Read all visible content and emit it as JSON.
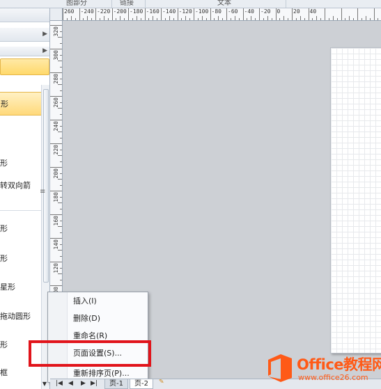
{
  "ribbon": {
    "groups": [
      "图部分",
      "链接",
      "文本"
    ]
  },
  "shapes_pane": {
    "items": [
      {
        "label": "形",
        "selected": true
      },
      {
        "label": "形",
        "selected": false
      },
      {
        "label": "转双向箭",
        "selected": false
      },
      {
        "label": "形",
        "selected": false
      },
      {
        "label": "形",
        "selected": false
      },
      {
        "label": "星形",
        "selected": false
      },
      {
        "label": "拖动圆形",
        "selected": false
      },
      {
        "label": "形",
        "selected": false
      },
      {
        "label": "框",
        "selected": false
      }
    ],
    "grip_glyph": "≡"
  },
  "ruler": {
    "horizontal": [
      "260",
      "-240",
      "-220",
      "-200",
      "-180",
      "-160",
      "-140",
      "-120",
      "-100",
      "-80",
      "-60",
      "-40",
      "-20",
      "0",
      "20",
      "40"
    ],
    "vertical": [
      "320",
      "300",
      "280",
      "260",
      "240",
      "220",
      "200",
      "180",
      "160",
      "140",
      "120",
      "100",
      "80"
    ]
  },
  "context_menu": {
    "items": [
      "插入(I)",
      "删除(D)",
      "重命名(R)",
      "页面设置(S)...",
      "重新排序页(P)..."
    ]
  },
  "page_tabs": {
    "tabs": [
      "页-1",
      "页-2"
    ],
    "active_index": 1
  },
  "watermark": {
    "title": "Office教程网",
    "url": "www.office26.com"
  },
  "colors": {
    "highlight_box": "#e1141b",
    "watermark": "#ff5a17",
    "selected_item": "#ffd97a"
  }
}
